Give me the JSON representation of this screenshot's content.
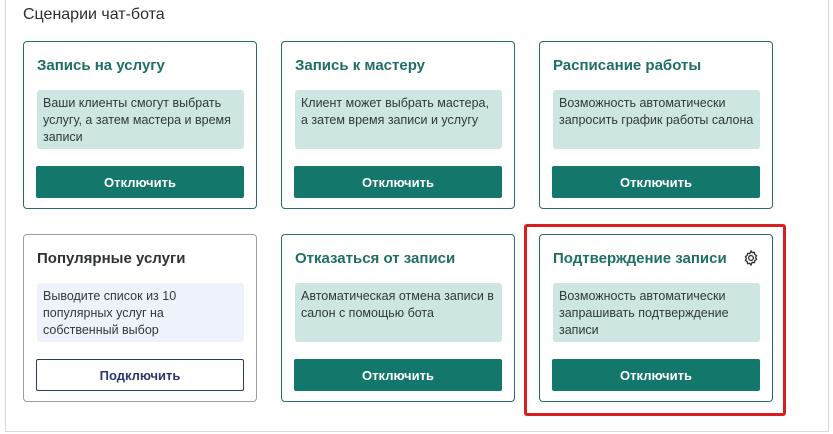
{
  "section": {
    "title": "Сценарии чат-бота"
  },
  "cards": [
    {
      "title": "Запись на услугу",
      "description": "Ваши клиенты смогут выбрать услугу, а затем мастера и время записи",
      "button_label": "Отключить",
      "state": "enabled"
    },
    {
      "title": "Запись к мастеру",
      "description": "Клиент может выбрать мастера, а затем время записи и услугу",
      "button_label": "Отключить",
      "state": "enabled"
    },
    {
      "title": "Расписание работы",
      "description": "Возможность автоматически запросить график работы салона",
      "button_label": "Отключить",
      "state": "enabled"
    },
    {
      "title": "Популярные услуги",
      "description": "Выводите список из 10 популярных услуг на собственный выбор",
      "button_label": "Подключить",
      "state": "disabled"
    },
    {
      "title": "Отказаться от записи",
      "description": "Автоматическая отмена записи в салон с помощью бота",
      "button_label": "Отключить",
      "state": "enabled"
    },
    {
      "title": "Подтверждение записи",
      "description": "Возможность автоматически запрашивать подтверждение записи",
      "button_label": "Отключить",
      "state": "enabled",
      "icon": "gear-icon"
    }
  ],
  "colors": {
    "accent": "#13786b",
    "title_active": "#1f6f65",
    "desc_active_bg": "#cde6e1",
    "desc_inactive_bg": "#eef2fb",
    "outline_button": "#2b3a6b",
    "highlight": "#d81e1e"
  }
}
